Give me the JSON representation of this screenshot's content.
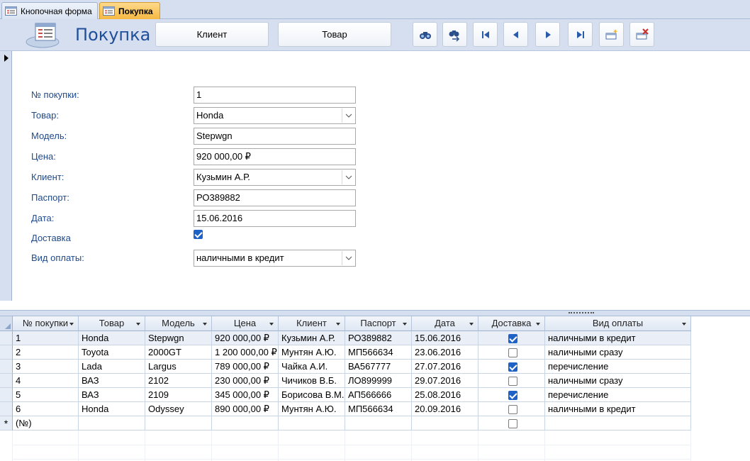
{
  "tabs": [
    {
      "label": "Кнопочная форма"
    },
    {
      "label": "Покупка"
    }
  ],
  "header": {
    "title": "Покупка",
    "client_button": "Клиент",
    "product_button": "Товар"
  },
  "form": {
    "fields": [
      {
        "label": "№ покупки:",
        "value": "1"
      },
      {
        "label": "Товар:",
        "value": "Honda"
      },
      {
        "label": "Модель:",
        "value": "Stepwgn"
      },
      {
        "label": "Цена:",
        "value": "920 000,00 ₽"
      },
      {
        "label": "Клиент:",
        "value": "Кузьмин А.Р."
      },
      {
        "label": "Паспорт:",
        "value": "РО389882"
      },
      {
        "label": "Дата:",
        "value": "15.06.2016"
      },
      {
        "label": "Доставка",
        "value": true
      },
      {
        "label": "Вид оплаты:",
        "value": "наличными в кредит"
      }
    ]
  },
  "table": {
    "columns": [
      "№ покупки",
      "Товар",
      "Модель",
      "Цена",
      "Клиент",
      "Паспорт",
      "Дата",
      "Доставка",
      "Вид оплаты"
    ],
    "rows": [
      {
        "id": "1",
        "product": "Honda",
        "model": "Stepwgn",
        "price": "920 000,00 ₽",
        "client": "Кузьмин А.Р.",
        "passport": "РО389882",
        "date": "15.06.2016",
        "delivery": true,
        "payment": "наличными в кредит"
      },
      {
        "id": "2",
        "product": "Toyota",
        "model": "2000GT",
        "price": "1 200 000,00 ₽",
        "client": "Мунтян А.Ю.",
        "passport": "МП566634",
        "date": "23.06.2016",
        "delivery": false,
        "payment": "наличными сразу"
      },
      {
        "id": "3",
        "product": "Lada",
        "model": "Largus",
        "price": "789 000,00 ₽",
        "client": "Чайка А.И.",
        "passport": "ВА567777",
        "date": "27.07.2016",
        "delivery": true,
        "payment": "перечисление"
      },
      {
        "id": "4",
        "product": "ВАЗ",
        "model": "2102",
        "price": "230 000,00 ₽",
        "client": "Чичиков В.Б.",
        "passport": "ЛО899999",
        "date": "29.07.2016",
        "delivery": false,
        "payment": "наличными сразу"
      },
      {
        "id": "5",
        "product": "ВАЗ",
        "model": "2109",
        "price": "345 000,00 ₽",
        "client": "Борисова В.М.",
        "passport": "АП566666",
        "date": "25.08.2016",
        "delivery": true,
        "payment": "перечисление"
      },
      {
        "id": "6",
        "product": "Honda",
        "model": "Odyssey",
        "price": "890 000,00 ₽",
        "client": "Мунтян А.Ю.",
        "passport": "МП566634",
        "date": "20.09.2016",
        "delivery": false,
        "payment": "наличными в кредит"
      }
    ],
    "new_row_id": "(№)",
    "new_row_marker": "*",
    "current_row_marker": "▶"
  },
  "icons": [
    "form-icon",
    "find-icon",
    "find-next-icon",
    "first-record-icon",
    "previous-record-icon",
    "next-record-icon",
    "last-record-icon",
    "new-record-icon",
    "delete-record-icon",
    "chevron-down-icon"
  ],
  "colors": {
    "accent": "#1f4f9a",
    "ribbon": "#d5dff0",
    "active_tab": "#f6b841",
    "checkbox": "#1f62c6"
  }
}
